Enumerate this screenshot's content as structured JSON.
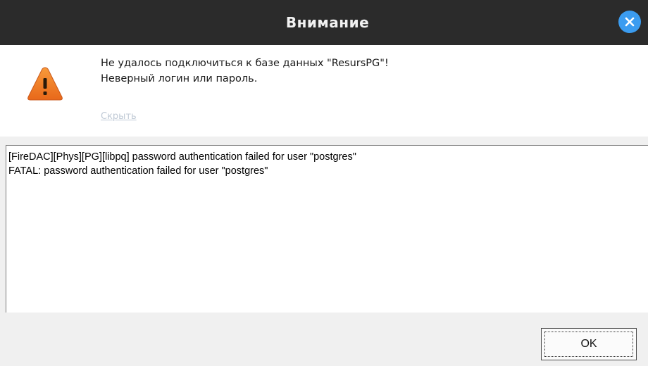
{
  "window": {
    "title": "Внимание",
    "close_icon": "close-icon"
  },
  "message": {
    "icon": "warning-icon",
    "line1": "Не удалось подключиться к базе данных \"ResursPG\"!",
    "line2": "Неверный логин или пароль.",
    "hide_link": "Скрыть"
  },
  "details": {
    "lines": [
      "[FireDAC][Phys][PG][libpq] password authentication failed for user \"postgres\"",
      "FATAL:  password authentication failed for user \"postgres\""
    ]
  },
  "buttons": {
    "ok_label": "OK"
  },
  "colors": {
    "titlebar": "#2b2b2b",
    "close_button": "#3b9cf0",
    "warning_fill": "#f07d22",
    "link": "#c0cad6"
  }
}
